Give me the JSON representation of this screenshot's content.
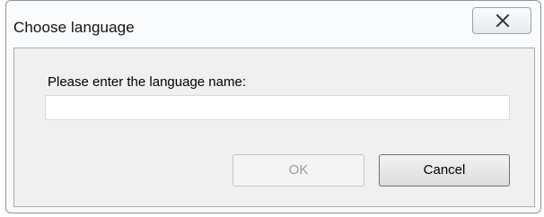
{
  "window": {
    "title": "Choose language",
    "close_icon": "close-x-icon"
  },
  "form": {
    "prompt_label": "Please enter the language name:",
    "language_value": "",
    "language_placeholder": ""
  },
  "buttons": {
    "ok_label": "OK",
    "ok_enabled": false,
    "cancel_label": "Cancel"
  }
}
